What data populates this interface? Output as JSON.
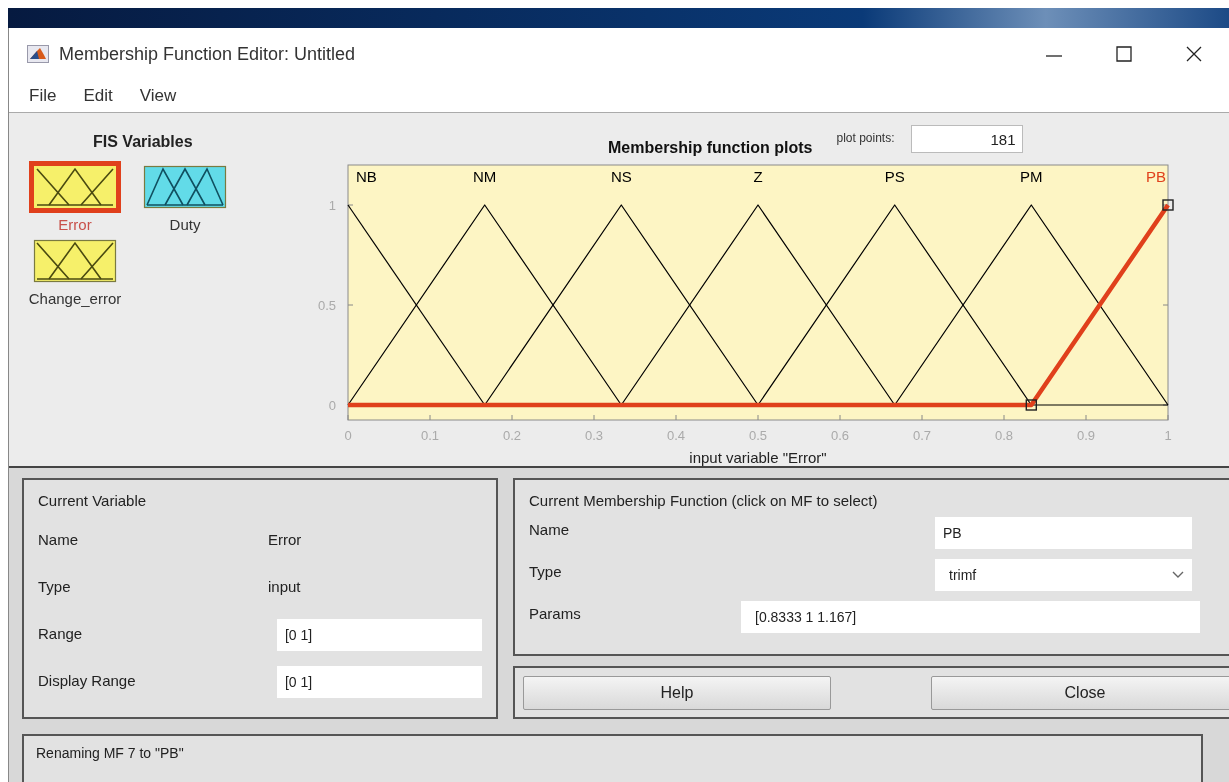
{
  "window": {
    "title": "Membership Function Editor: Untitled"
  },
  "menu": [
    "File",
    "Edit",
    "View"
  ],
  "fis_variables": {
    "title": "FIS Variables",
    "items": [
      {
        "label": "Error",
        "kind": "input",
        "selected": true
      },
      {
        "label": "Duty",
        "kind": "output",
        "selected": false
      },
      {
        "label": "Change_error",
        "kind": "input",
        "selected": false
      }
    ]
  },
  "plot": {
    "plot_points": {
      "label": "plot points:",
      "value": "181"
    },
    "chart_data": {
      "type": "line",
      "title": "Membership function plots",
      "xlabel": "input variable \"Error\"",
      "x": [
        0,
        0.1667,
        0.3333,
        0.5,
        0.6667,
        0.8333,
        1
      ],
      "xlim": [
        0,
        1
      ],
      "ylim": [
        -0.075,
        1.2
      ],
      "xticks": [
        0,
        0.1,
        0.2,
        0.3,
        0.4,
        0.5,
        0.6,
        0.7,
        0.8,
        0.9,
        1
      ],
      "yticks": [
        0,
        0.5,
        1
      ],
      "series": [
        {
          "name": "NB",
          "color": "#000000",
          "values": [
            1,
            0,
            null,
            null,
            null,
            null,
            null
          ]
        },
        {
          "name": "NM",
          "color": "#000000",
          "values": [
            0,
            1,
            0,
            null,
            null,
            null,
            null
          ]
        },
        {
          "name": "NS",
          "color": "#000000",
          "values": [
            null,
            0,
            1,
            0,
            null,
            null,
            null
          ]
        },
        {
          "name": "Z",
          "color": "#000000",
          "values": [
            null,
            null,
            0,
            1,
            0,
            null,
            null
          ]
        },
        {
          "name": "PS",
          "color": "#000000",
          "values": [
            null,
            null,
            null,
            0,
            1,
            0,
            null
          ]
        },
        {
          "name": "PM",
          "color": "#000000",
          "values": [
            null,
            null,
            null,
            null,
            0,
            1,
            0
          ]
        },
        {
          "name": "PB",
          "color": "#e0401c",
          "values": [
            0,
            0,
            0,
            0,
            0,
            0,
            1
          ]
        }
      ]
    }
  },
  "current_variable": {
    "title": "Current Variable",
    "rows": [
      {
        "label": "Name",
        "value": "Error",
        "kind": "text"
      },
      {
        "label": "Type",
        "value": "input",
        "kind": "text"
      },
      {
        "label": "Range",
        "value": "[0 1]",
        "kind": "field"
      },
      {
        "label": "Display Range",
        "value": "[0 1]",
        "kind": "field"
      }
    ]
  },
  "current_mf": {
    "title": "Current Membership Function (click on MF to select)",
    "rows": [
      {
        "label": "Name",
        "value": "PB",
        "kind": "field"
      },
      {
        "label": "Type",
        "value": "trimf",
        "kind": "dropdown"
      },
      {
        "label": "Params",
        "value": "[0.8333 1 1.167]",
        "kind": "wide_field"
      }
    ]
  },
  "buttons": [
    "Help",
    "Close"
  ],
  "status": "Renaming MF 7 to \"PB\""
}
